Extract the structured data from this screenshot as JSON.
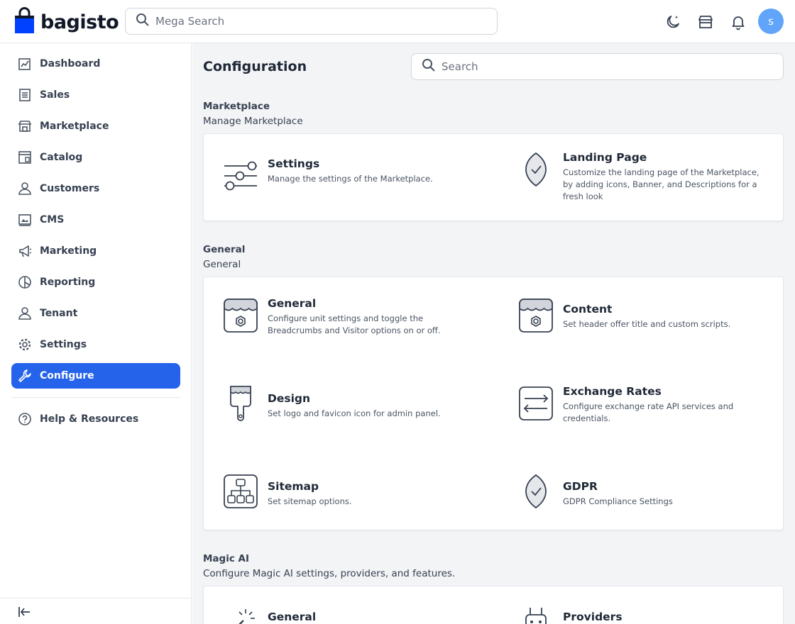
{
  "header": {
    "logo_text": "bagisto",
    "search_placeholder": "Mega Search",
    "icons": [
      "moon-icon",
      "store-icon",
      "bell-icon"
    ],
    "avatar_letter": "s"
  },
  "sidebar": {
    "items": [
      {
        "label": "Dashboard",
        "icon": "dashboard-icon"
      },
      {
        "label": "Sales",
        "icon": "sales-icon"
      },
      {
        "label": "Marketplace",
        "icon": "marketplace-icon"
      },
      {
        "label": "Catalog",
        "icon": "catalog-icon"
      },
      {
        "label": "Customers",
        "icon": "customers-icon"
      },
      {
        "label": "CMS",
        "icon": "cms-icon"
      },
      {
        "label": "Marketing",
        "icon": "marketing-icon"
      },
      {
        "label": "Reporting",
        "icon": "reporting-icon"
      },
      {
        "label": "Tenant",
        "icon": "tenant-icon"
      },
      {
        "label": "Settings",
        "icon": "settings-icon"
      },
      {
        "label": "Configure",
        "icon": "configure-icon",
        "active": true
      }
    ],
    "help_label": "Help & Resources"
  },
  "main": {
    "title": "Configuration",
    "search_placeholder": "Search",
    "sections": [
      {
        "title": "Marketplace",
        "description": "Manage Marketplace",
        "items": [
          {
            "title": "Settings",
            "description": "Manage the settings of the Marketplace."
          },
          {
            "title": "Landing Page",
            "description": "Customize the landing page of the Marketplace, by adding icons, Banner, and Descriptions for a fresh look"
          }
        ]
      },
      {
        "title": "General",
        "description": "General",
        "items": [
          {
            "title": "General",
            "description": "Configure unit settings and toggle the Breadcrumbs and Visitor options on or off."
          },
          {
            "title": "Content",
            "description": "Set header offer title and custom scripts."
          },
          {
            "title": "Design",
            "description": "Set logo and favicon icon for admin panel."
          },
          {
            "title": "Exchange Rates",
            "description": "Configure exchange rate API services and credentials."
          },
          {
            "title": "Sitemap",
            "description": "Set sitemap options."
          },
          {
            "title": "GDPR",
            "description": "GDPR Compliance Settings"
          }
        ]
      },
      {
        "title": "Magic AI",
        "description": "Configure Magic AI settings, providers, and features.",
        "items": [
          {
            "title": "General",
            "description": ""
          },
          {
            "title": "Providers",
            "description": ""
          }
        ]
      }
    ]
  },
  "colors": {
    "accent": "#2563eb",
    "avatar": "#60a5fa",
    "logo_bag": "#0041ff"
  }
}
